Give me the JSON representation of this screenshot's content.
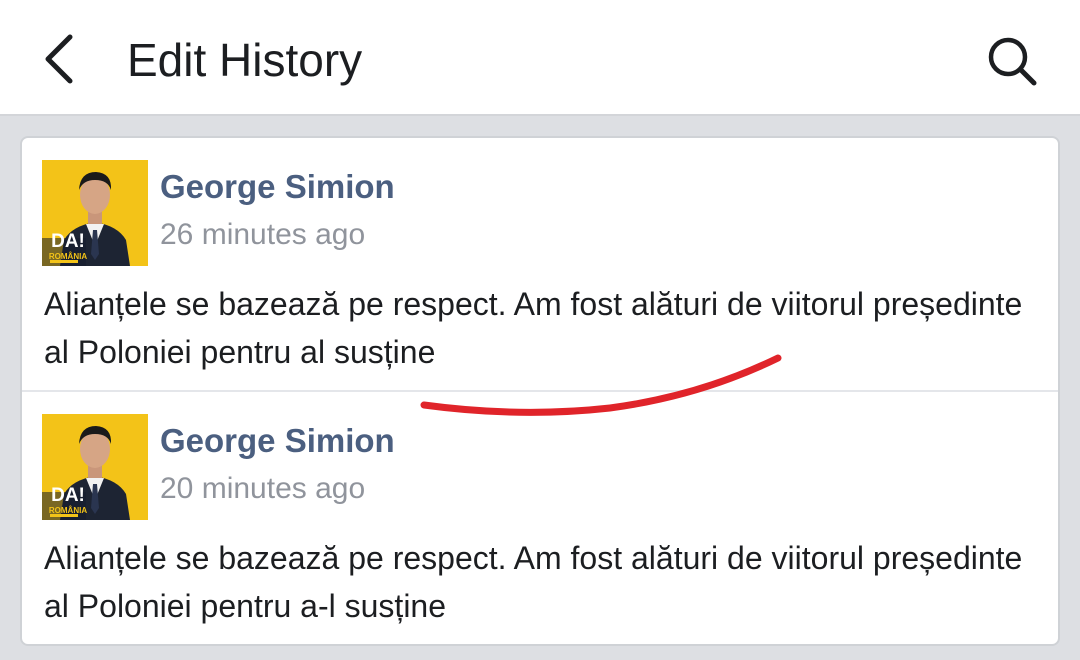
{
  "header": {
    "title": "Edit History",
    "back_icon": "chevron-left-icon",
    "search_icon": "search-icon"
  },
  "entries": [
    {
      "author": "George Simion",
      "time": "26 minutes ago",
      "text": "Alianțele se bazează pe respect. Am fost alături de viitorul președinte al Poloniei pentru al susține",
      "avatar_badge": "DA!",
      "avatar_sub": "ROMÂNIA"
    },
    {
      "author": "George Simion",
      "time": "20 minutes ago",
      "text": "Alianțele se bazează pe respect. Am fost alături de viitorul președinte al Poloniei pentru a-l susține",
      "avatar_badge": "DA!",
      "avatar_sub": "ROMÂNIA"
    }
  ],
  "colors": {
    "author": "#4b5f80",
    "avatar_bg": "#f3c318",
    "annotation": "#e0242a"
  }
}
